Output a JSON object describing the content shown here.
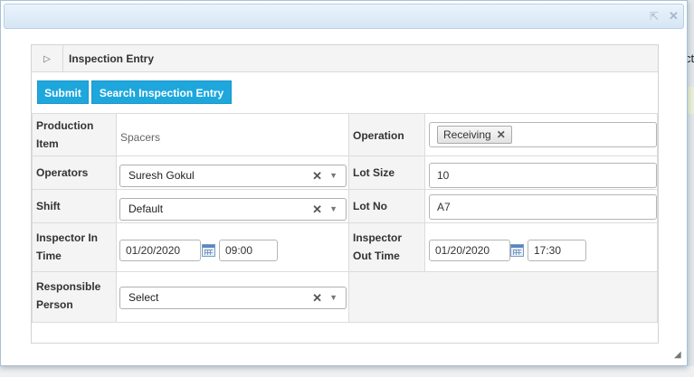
{
  "page_background_text": "ct",
  "dialog": {
    "popout_icon": "popout-icon",
    "close_icon": "close-icon",
    "panel": {
      "title": "Inspection Entry",
      "collapse_icon": "collapse-arrow-icon",
      "buttons": {
        "submit": "Submit",
        "search": "Search Inspection Entry"
      },
      "fields": {
        "production_item": {
          "label_line1": "Production",
          "label_line2": "Item",
          "value": "Spacers"
        },
        "operation": {
          "label": "Operation",
          "tag": "Receiving"
        },
        "operators": {
          "label": "Operators",
          "value": "Suresh Gokul"
        },
        "lot_size": {
          "label": "Lot Size",
          "value": "10"
        },
        "shift": {
          "label": "Shift",
          "value": "Default"
        },
        "lot_no": {
          "label": "Lot No",
          "value": "A7"
        },
        "inspector_in_time": {
          "label_line1": "Inspector In",
          "label_line2": "Time",
          "date": "01/20/2020",
          "time": "09:00"
        },
        "inspector_out_time": {
          "label_line1": "Inspector",
          "label_line2": "Out Time",
          "date": "01/20/2020",
          "time": "17:30"
        },
        "responsible_person": {
          "label_line1": "Responsible",
          "label_line2": "Person",
          "value": "Select"
        }
      }
    }
  }
}
